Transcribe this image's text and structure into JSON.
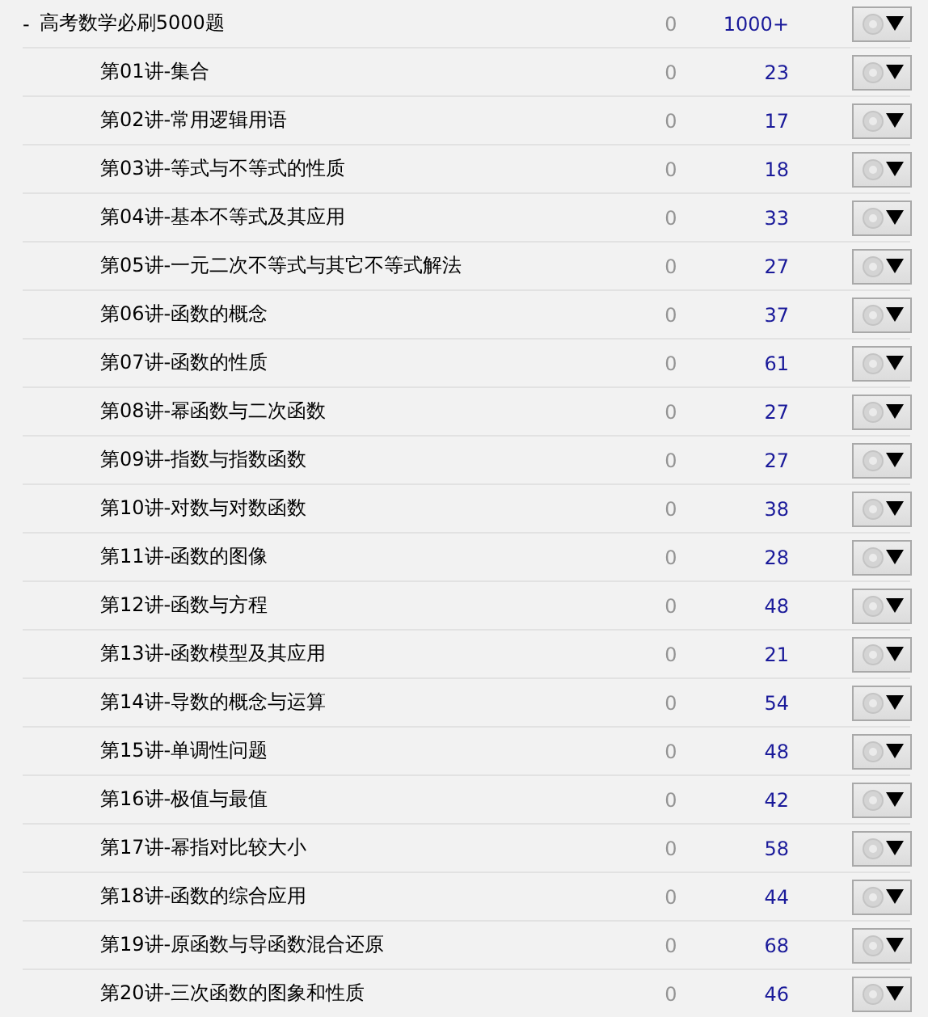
{
  "root": {
    "toggle": "-",
    "title": "高考数学必刷5000题",
    "zero": "0",
    "count": "1000+",
    "expanded": true
  },
  "children": [
    {
      "title": "第01讲-集合",
      "zero": "0",
      "count": "23"
    },
    {
      "title": "第02讲-常用逻辑用语",
      "zero": "0",
      "count": "17"
    },
    {
      "title": "第03讲-等式与不等式的性质",
      "zero": "0",
      "count": "18"
    },
    {
      "title": "第04讲-基本不等式及其应用",
      "zero": "0",
      "count": "33"
    },
    {
      "title": "第05讲-一元二次不等式与其它不等式解法",
      "zero": "0",
      "count": "27"
    },
    {
      "title": "第06讲-函数的概念",
      "zero": "0",
      "count": "37"
    },
    {
      "title": "第07讲-函数的性质",
      "zero": "0",
      "count": "61"
    },
    {
      "title": "第08讲-幂函数与二次函数",
      "zero": "0",
      "count": "27"
    },
    {
      "title": "第09讲-指数与指数函数",
      "zero": "0",
      "count": "27"
    },
    {
      "title": "第10讲-对数与对数函数",
      "zero": "0",
      "count": "38"
    },
    {
      "title": "第11讲-函数的图像",
      "zero": "0",
      "count": "28"
    },
    {
      "title": "第12讲-函数与方程",
      "zero": "0",
      "count": "48"
    },
    {
      "title": "第13讲-函数模型及其应用",
      "zero": "0",
      "count": "21"
    },
    {
      "title": "第14讲-导数的概念与运算",
      "zero": "0",
      "count": "54"
    },
    {
      "title": "第15讲-单调性问题",
      "zero": "0",
      "count": "48"
    },
    {
      "title": "第16讲-极值与最值",
      "zero": "0",
      "count": "42"
    },
    {
      "title": "第17讲-幂指对比较大小",
      "zero": "0",
      "count": "58"
    },
    {
      "title": "第18讲-函数的综合应用",
      "zero": "0",
      "count": "44"
    },
    {
      "title": "第19讲-原函数与导函数混合还原",
      "zero": "0",
      "count": "68"
    },
    {
      "title": "第20讲-三次函数的图象和性质",
      "zero": "0",
      "count": "46"
    }
  ]
}
